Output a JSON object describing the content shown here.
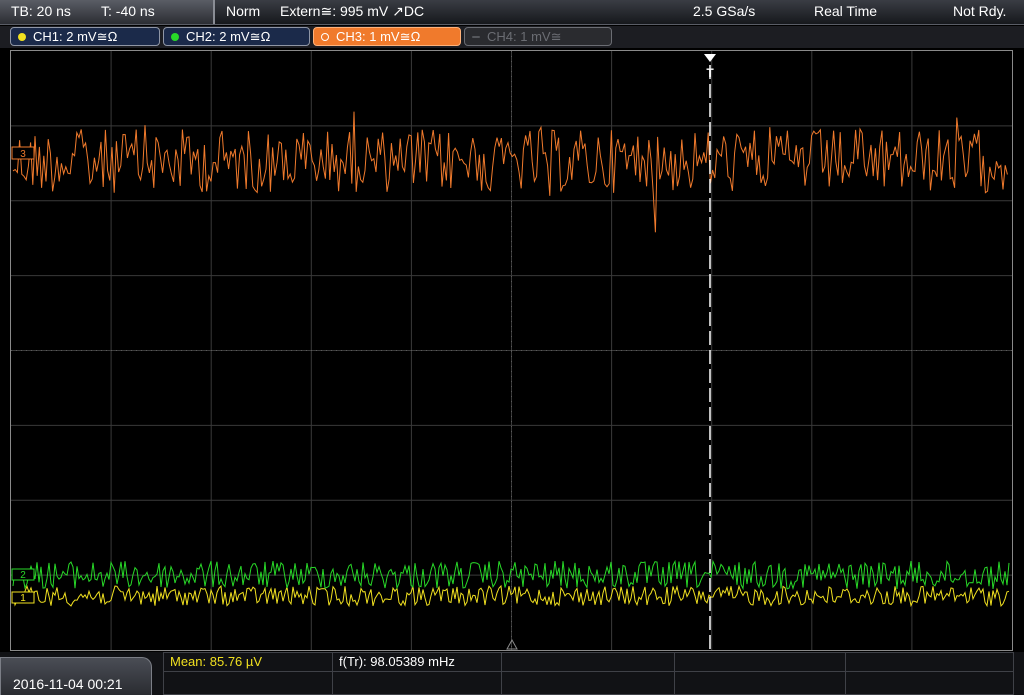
{
  "status_bar": {
    "timebase": "TB: 20 ns",
    "trigger_offset": "T: -40 ns",
    "trigger_mode": "Norm",
    "trigger_source": "Extern≅: 995 mV ↗DC",
    "sample_rate": "2.5 GSa/s",
    "acq_mode": "Real Time",
    "status": "Not Rdy."
  },
  "channels": [
    {
      "label": "CH1: 2 mV≅Ω",
      "color": "#f0e020",
      "active": true
    },
    {
      "label": "CH2: 2 mV≅Ω",
      "color": "#28d828",
      "active": true
    },
    {
      "label": "CH3: 1 mV≅Ω",
      "color": "#f07a2c",
      "active": true,
      "selected": true
    },
    {
      "label": "CH4: 1 mV≅",
      "color": "#6b6d73",
      "active": false
    }
  ],
  "markers": {
    "ch3": "3",
    "ch2": "2",
    "ch1": "1",
    "trigger": "T"
  },
  "date_time": "2016-11-04 00:21",
  "measurements": {
    "mean": "Mean: 85.76 µV",
    "freq": "f(Tr): 98.05389 mHz"
  }
}
